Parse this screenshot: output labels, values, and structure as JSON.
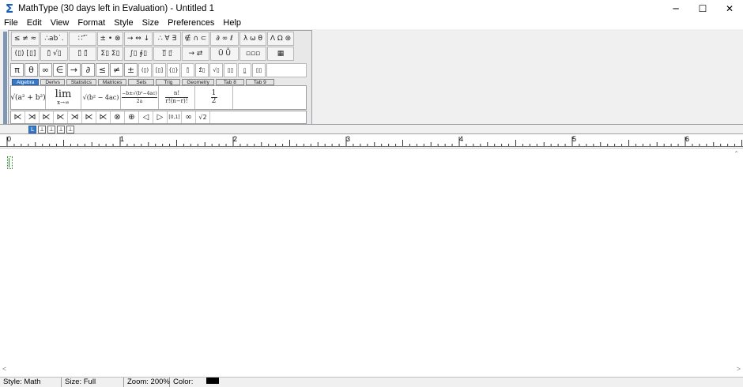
{
  "window": {
    "title": "MathType (30 days left in Evaluation) - Untitled 1",
    "app_icon": "sigma-icon",
    "controls": [
      "minimize-icon",
      "maximize-icon",
      "close-icon"
    ]
  },
  "menu": [
    "File",
    "Edit",
    "View",
    "Format",
    "Style",
    "Size",
    "Preferences",
    "Help"
  ],
  "palette": {
    "symbol_row1": [
      "≤ ≠ ≈",
      "∴ab˙.",
      "∷ ⃗ ⃛",
      "± • ⊗",
      "→ ⇔ ↓",
      "∴ ∀ ∃",
      "∉ ∩ ⊂",
      "∂ ∞ ℓ",
      "λ ω θ",
      "Λ Ω ⊛"
    ],
    "symbol_row2": [
      "(▯) [▯]",
      "▯̄ √▯",
      "▯̈ ▯̃",
      "Σ▯ Σ▯",
      "∫▯ ∮▯",
      "▯̅ ▯⃗",
      "→ ⇄",
      "Ū Ṻ",
      "▫▫▫",
      "▦"
    ],
    "small_row": [
      "π",
      "θ",
      "∞",
      "∈",
      "→",
      "∂",
      "≤",
      "≠",
      "±",
      "(▯)",
      "[▯]",
      "{▯}",
      "▯̄",
      "Σ̄▯",
      "√▯",
      "▯▯",
      "▯̲",
      "▯▯"
    ],
    "tabs": [
      "Algebra",
      "Derivs",
      "Statistics",
      "Matrices",
      "Sets",
      "Trig",
      "Geometry",
      "Tab 8",
      "Tab 9"
    ],
    "active_tab": "Algebra",
    "templates": {
      "t1": "√(a² + b²)",
      "t2_top": "lim",
      "t2_bot": "x→∞",
      "t3": "√(b² − 4ac)",
      "t4_num": "−b±√(b²−4ac)",
      "t4_den": "2a",
      "t5_num": "n!",
      "t5_den": "r!(n−r)!",
      "t6_num": "1",
      "t6_den": "2"
    },
    "bottom_row": [
      "⋉",
      "⋊",
      "⋉",
      "⋉",
      "⋊",
      "⋉",
      "⋉",
      "⊗",
      "⊕",
      "◁",
      "▷",
      "[0,1]",
      "∞",
      "√2"
    ]
  },
  "tabstops": [
    "L",
    "⊥",
    "⊥",
    "⊥",
    "⊥"
  ],
  "ruler": {
    "labels": [
      "0",
      "1",
      "2",
      "3",
      "4",
      "5",
      "6"
    ]
  },
  "status": {
    "style": "Style: Math",
    "size": "Size: Full",
    "zoom": "Zoom: 200%",
    "color_label": "Color:",
    "color_value": "#000000"
  }
}
